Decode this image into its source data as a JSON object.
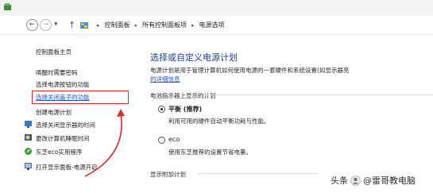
{
  "breadcrumb": {
    "items": [
      "控制面板",
      "所有控制面板项",
      "电源选项"
    ]
  },
  "sidebar": {
    "home": "控制面板主页",
    "links": [
      {
        "label": "唤醒时需要密码",
        "icon": null
      },
      {
        "label": "选择电源按钮的功能",
        "icon": null
      },
      {
        "label": "选择关闭盖子的功能",
        "icon": null,
        "highlighted": true
      },
      {
        "label": "创建电源计划",
        "icon": null
      },
      {
        "label": "选择关闭显示器的时间",
        "icon": "monitor-icon"
      },
      {
        "label": "更改计算机睡眠时间",
        "icon": "moon-icon"
      },
      {
        "label": "东芝eco实用程序",
        "icon": "eco-icon"
      },
      {
        "label": "打开显示面板-电源开启",
        "icon": "display-icon"
      }
    ]
  },
  "main": {
    "title": "选择或自定义电源计划",
    "description": "电源计划是用于管理计算机如何使用电源的一套硬件和系统设置(如显示器亮",
    "description_link": "的详细信息",
    "group_label": "电池指示器上显示的计划",
    "plans": [
      {
        "name": "平衡 (推荐)",
        "description": "利用可用的硬件自动平衡功耗与性能。",
        "selected": true
      },
      {
        "name": "eco",
        "description": "使用东芝推荐的设置节省电量。",
        "selected": false
      }
    ],
    "bottom_label": "显示附加计划"
  },
  "watermark": {
    "prefix": "头条",
    "text": "@雷哥教电脑"
  },
  "colors": {
    "accent": "#e02a2a",
    "link": "#1a56c4",
    "title": "#1c3f94"
  }
}
